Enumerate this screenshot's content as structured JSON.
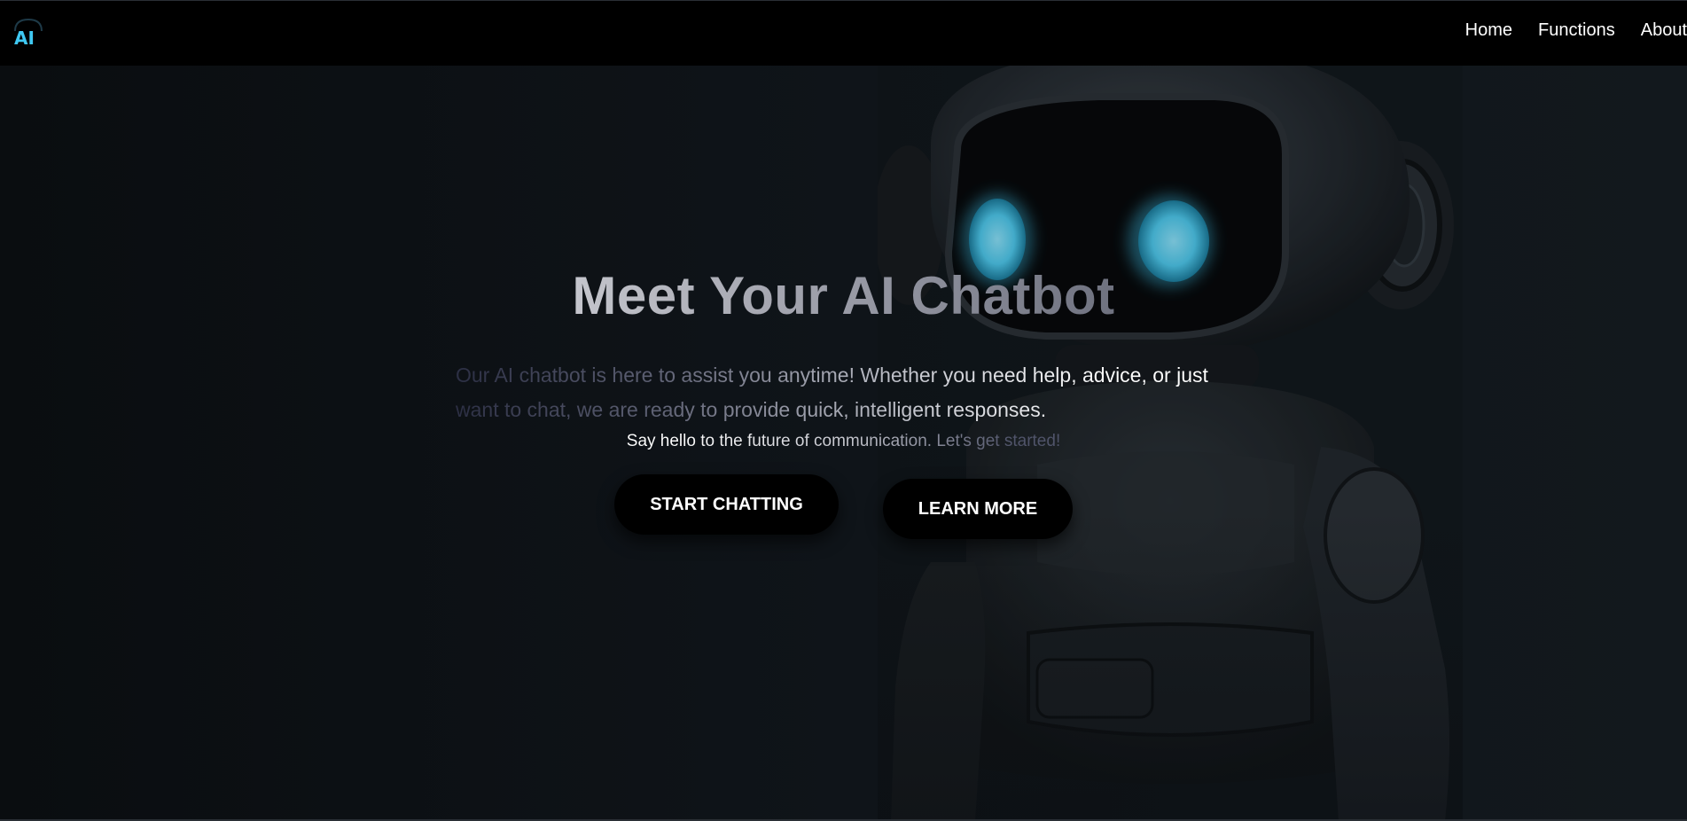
{
  "navbar": {
    "logo_text": "AI",
    "links": [
      {
        "label": "Home"
      },
      {
        "label": "Functions"
      },
      {
        "label": "About"
      }
    ]
  },
  "hero": {
    "title": "Meet Your AI Chatbot",
    "description": "Our AI chatbot is here to assist you anytime! Whether you need help, advice, or just want to chat, we are ready to provide quick, intelligent responses.",
    "subtitle": "Say hello to the future of communication. Let's get started!",
    "buttons": {
      "start": "START CHATTING",
      "learn": "LEARN MORE"
    }
  },
  "colors": {
    "nav_background": "#000000",
    "accent_cyan": "#3fc8f2",
    "page_background": "#0b0e12",
    "button_background": "#000000"
  },
  "icons": {
    "logo": "ai-logo-icon",
    "hero_image": "robot-illustration"
  }
}
